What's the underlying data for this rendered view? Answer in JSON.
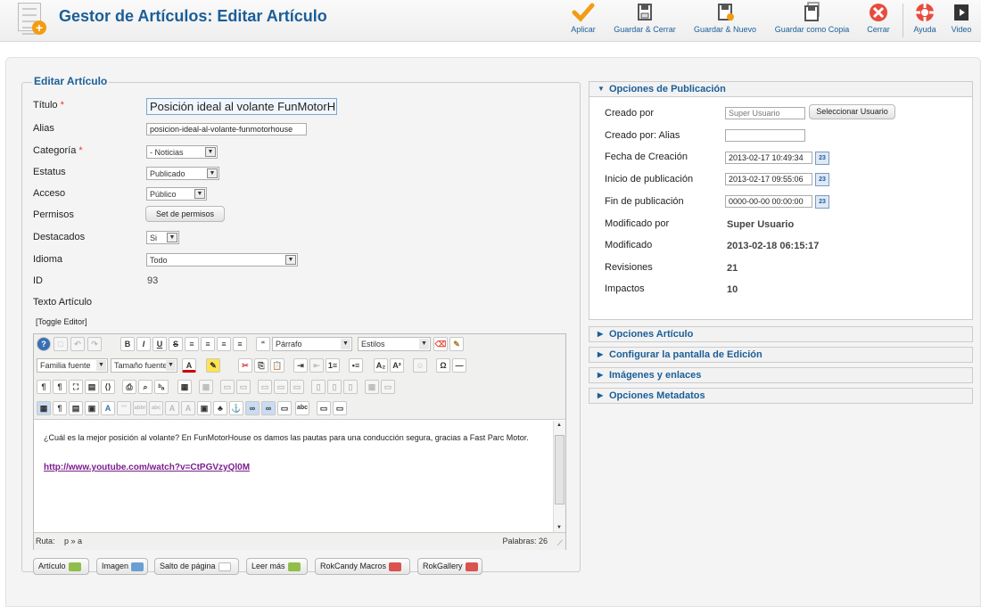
{
  "header": {
    "title": "Gestor de Artículos: Editar Artículo",
    "toolbar": [
      {
        "id": "apply",
        "label": "Aplicar",
        "icon": "checkmark-icon",
        "color": "#f39c12"
      },
      {
        "id": "save-close",
        "label": "Guardar & Cerrar",
        "icon": "save-icon",
        "color": "#555555"
      },
      {
        "id": "save-new",
        "label": "Guardar & Nuevo",
        "icon": "save-new-icon",
        "color": "#555555"
      },
      {
        "id": "save-copy",
        "label": "Guardar como Copia",
        "icon": "save-copy-icon",
        "color": "#555555"
      },
      {
        "id": "close",
        "label": "Cerrar",
        "icon": "close-icon",
        "color": "#e74c3c"
      },
      {
        "id": "help",
        "label": "Ayuda",
        "icon": "lifebuoy-icon",
        "color": "#e74c3c"
      },
      {
        "id": "video",
        "label": "Video",
        "icon": "film-icon",
        "color": "#333333"
      }
    ]
  },
  "form": {
    "legend": "Editar Artículo",
    "fields": {
      "titulo_label": "Título",
      "titulo_value": "Posición ideal al volante FunMotorH",
      "alias_label": "Alias",
      "alias_value": "posicion-ideal-al-volante-funmotorhouse",
      "categoria_label": "Categoría",
      "categoria_value": "- Noticias",
      "estatus_label": "Estatus",
      "estatus_value": "Publicado",
      "acceso_label": "Acceso",
      "acceso_value": "Público",
      "permisos_label": "Permisos",
      "permisos_button": "Set de permisos",
      "destacados_label": "Destacados",
      "destacados_value": "Si",
      "idioma_label": "Idioma",
      "idioma_value": "Todo",
      "id_label": "ID",
      "id_value": "93",
      "texto_label": "Texto Artículo",
      "toggle_editor": "[Toggle Editor]",
      "required_mark": "*"
    }
  },
  "editor": {
    "format_select": "Párrafo",
    "styles_select": "Estilos",
    "font_family_select": "Familia fuente",
    "font_size_select": "Tamaño fuente",
    "content_text": "¿Cuál es la mejor posición al volante? En FunMotorHouse os damos las pautas para una conducción segura, gracias a Fast Parc Motor.",
    "content_link": "http://www.youtube.com/watch?v=CtPGVzyQl0M",
    "path_label": "Ruta:",
    "path_value": "p » a",
    "word_count": "Palabras: 26"
  },
  "editor_buttons": [
    {
      "label": "Artículo",
      "color": "#8fbf4a"
    },
    {
      "label": "Imagen",
      "color": "#6a9fd4"
    },
    {
      "label": "Salto de página",
      "color": "#bbbbbb"
    },
    {
      "label": "Leer más",
      "color": "#8fbf4a"
    },
    {
      "label": "RokCandy Macros",
      "color": "#d9534f"
    },
    {
      "label": "RokGallery",
      "color": "#d9534f"
    }
  ],
  "publishing": {
    "header": "Opciones de Publicación",
    "created_by_label": "Creado por",
    "created_by_value": "Super Usuario",
    "select_user_button": "Seleccionar Usuario",
    "created_alias_label": "Creado por: Alias",
    "created_alias_value": "",
    "created_date_label": "Fecha de Creación",
    "created_date_value": "2013-02-17 10:49:34",
    "publish_up_label": "Inicio de publicación",
    "publish_up_value": "2013-02-17 09:55:06",
    "publish_down_label": "Fin de publicación",
    "publish_down_value": "0000-00-00 00:00:00",
    "modified_by_label": "Modificado por",
    "modified_by_value": "Super Usuario",
    "modified_label": "Modificado",
    "modified_value": "2013-02-18 06:15:17",
    "revisions_label": "Revisiones",
    "revisions_value": "21",
    "hits_label": "Impactos",
    "hits_value": "10",
    "calendar_icon_text": "23"
  },
  "collapsed_panels": [
    "Opciones Artículo",
    "Configurar la pantalla de Edición",
    "Imágenes y enlaces",
    "Opciones Metadatos"
  ]
}
